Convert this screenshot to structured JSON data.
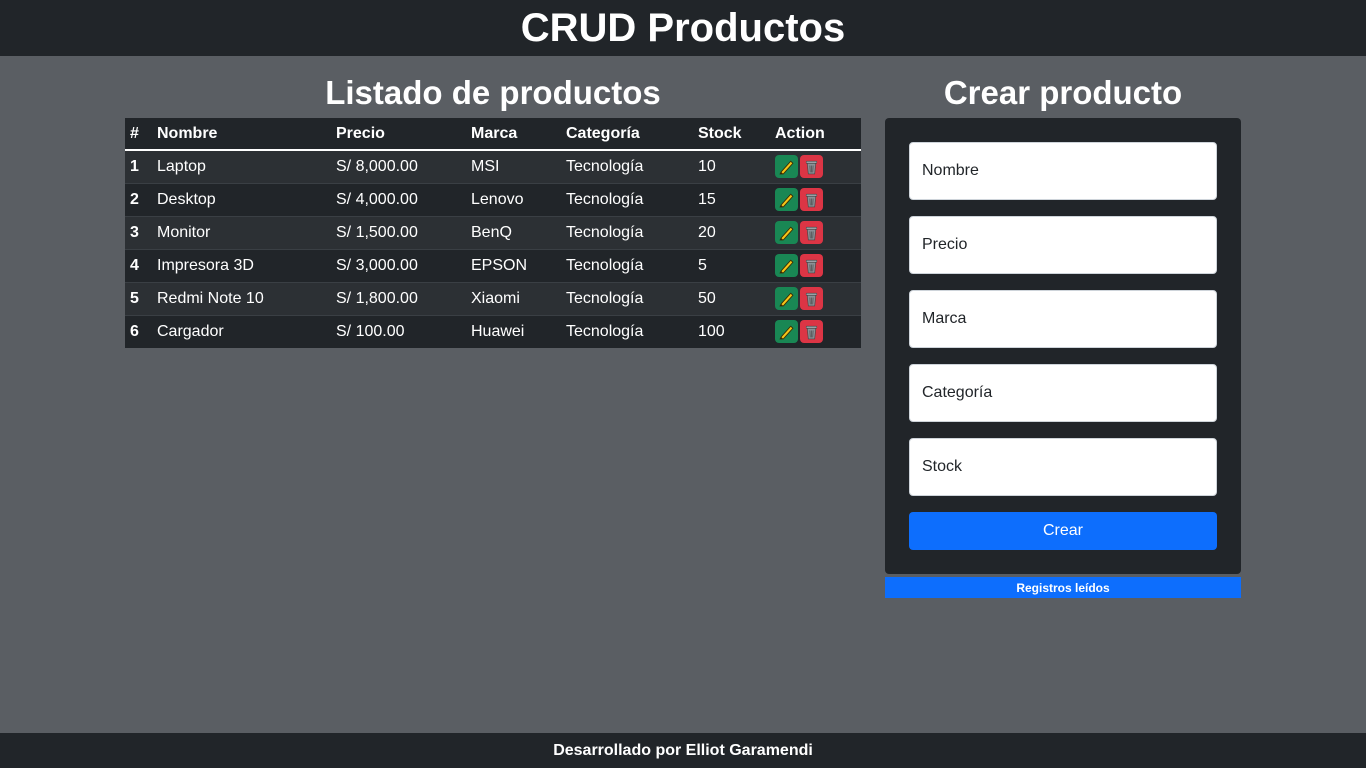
{
  "header": {
    "title": "CRUD Productos"
  },
  "list": {
    "title": "Listado de productos",
    "columns": [
      "#",
      "Nombre",
      "Precio",
      "Marca",
      "Categoría",
      "Stock",
      "Action"
    ],
    "rows": [
      {
        "id": "1",
        "nombre": "Laptop",
        "precio": "S/ 8,000.00",
        "marca": "MSI",
        "categoria": "Tecnología",
        "stock": "10"
      },
      {
        "id": "2",
        "nombre": "Desktop",
        "precio": "S/ 4,000.00",
        "marca": "Lenovo",
        "categoria": "Tecnología",
        "stock": "15"
      },
      {
        "id": "3",
        "nombre": "Monitor",
        "precio": "S/ 1,500.00",
        "marca": "BenQ",
        "categoria": "Tecnología",
        "stock": "20"
      },
      {
        "id": "4",
        "nombre": "Impresora 3D",
        "precio": "S/ 3,000.00",
        "marca": "EPSON",
        "categoria": "Tecnología",
        "stock": "5"
      },
      {
        "id": "5",
        "nombre": "Redmi Note 10",
        "precio": "S/ 1,800.00",
        "marca": "Xiaomi",
        "categoria": "Tecnología",
        "stock": "50"
      },
      {
        "id": "6",
        "nombre": "Cargador",
        "precio": "S/ 100.00",
        "marca": "Huawei",
        "categoria": "Tecnología",
        "stock": "100"
      }
    ],
    "icons": {
      "edit": "pencil-icon",
      "delete": "trash-icon"
    }
  },
  "form": {
    "title": "Crear producto",
    "nombre_placeholder": "Nombre",
    "precio_placeholder": "Precio",
    "marca_placeholder": "Marca",
    "categoria_placeholder": "Categoría",
    "stock_placeholder": "Stock",
    "submit_label": "Crear"
  },
  "status": {
    "text": "Registros leídos"
  },
  "footer": {
    "text": "Desarrollado por Elliot Garamendi"
  },
  "colors": {
    "background": "#5a5e63",
    "dark": "#212529",
    "primary": "#0d6efd",
    "success": "#198754",
    "danger": "#dc3545"
  }
}
